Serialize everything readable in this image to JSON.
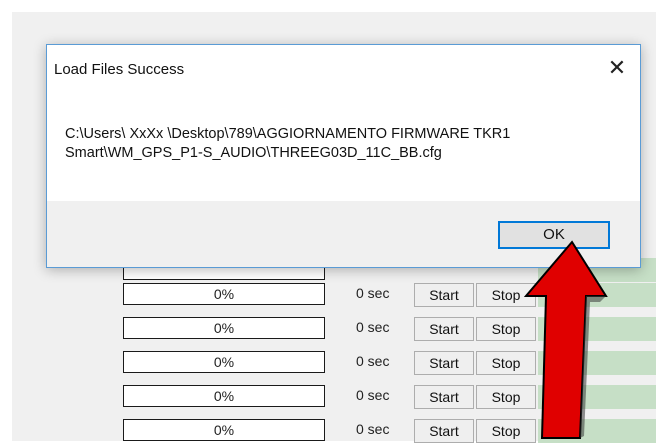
{
  "background": {
    "rows": [
      {
        "progress": "0%",
        "elapsed": "0 sec",
        "start_label": "Start",
        "stop_label": "Stop"
      },
      {
        "progress": "0%",
        "elapsed": "0 sec",
        "start_label": "Start",
        "stop_label": "Stop"
      },
      {
        "progress": "0%",
        "elapsed": "0 sec",
        "start_label": "Start",
        "stop_label": "Stop"
      },
      {
        "progress": "0%",
        "elapsed": "0 sec",
        "start_label": "Start",
        "stop_label": "Stop"
      },
      {
        "progress": "0%",
        "elapsed": "0 sec",
        "start_label": "Start",
        "stop_label": "Stop"
      }
    ],
    "status_color": "#c6dfc6"
  },
  "dialog": {
    "title": "Load Files Success",
    "close_icon": "close-icon",
    "message": "C:\\Users\\ XxXx \\Desktop\\789\\AGGIORNAMENTO FIRMWARE TKR1\nSmart\\WM_GPS_P1-S_AUDIO\\THREEG03D_11C_BB.cfg",
    "ok_label": "OK",
    "accent": "#0078d7"
  },
  "annotation": {
    "icon": "red-arrow-icon",
    "color": "#e00000"
  }
}
